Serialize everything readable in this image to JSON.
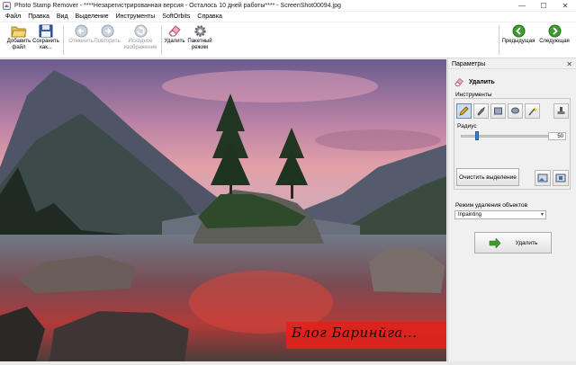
{
  "window": {
    "title": "Photo Stamp Remover - ****Незарегистрированная версия - Осталось 10 дней работы**** - ScreenShot00094.jpg",
    "minimize": "—",
    "maximize": "☐",
    "close": "✕"
  },
  "menu": [
    "Файл",
    "Правка",
    "Вид",
    "Выделение",
    "Инструменты",
    "SoftOrbits",
    "Справка"
  ],
  "toolbar": {
    "add_file": "Добавить\nфайл",
    "save_as": "Сохранить\nкак...",
    "undo": "Отменить",
    "redo": "Повторить",
    "original": "Исходное\nизображение",
    "remove": "Удалить",
    "batch": "Пакетный\nрежим",
    "previous": "Предыдущая",
    "next": "Следующая"
  },
  "image": {
    "watermark_text": "Блог Баринйга..."
  },
  "panel": {
    "title": "Параметры",
    "close": "✕",
    "tool_title": "Удалить",
    "tools_label": "Инструменты",
    "radius_label": "Радиус",
    "radius_value": "50",
    "radius_fraction": 0.17,
    "clear_selection": "Очистить выделение",
    "mode_label": "Режим удаления объектов",
    "mode_value": "Inpainting",
    "remove_button": "Удалить"
  },
  "colors": {
    "accent_green": "#3f9a2f",
    "sky_pink": "#d98fa6",
    "watermark_red": "#e0231b"
  }
}
